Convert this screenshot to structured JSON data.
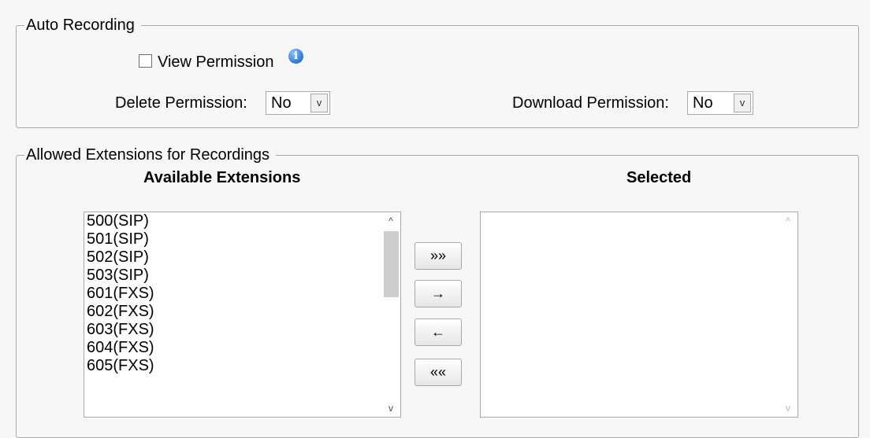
{
  "auto_recording": {
    "legend": "Auto Recording",
    "view_permission_label": "View Permission",
    "view_permission_checked": false,
    "info_glyph": "i",
    "delete_permission_label": "Delete Permission:",
    "delete_permission_value": "No",
    "download_permission_label": "Download Permission:",
    "download_permission_value": "No"
  },
  "allowed_extensions": {
    "legend": "Allowed Extensions for Recordings",
    "available_heading": "Available Extensions",
    "selected_heading": "Selected",
    "available": [
      "500(SIP)",
      "501(SIP)",
      "502(SIP)",
      "503(SIP)",
      "601(FXS)",
      "602(FXS)",
      "603(FXS)",
      "604(FXS)",
      "605(FXS)"
    ],
    "selected": [],
    "buttons": {
      "add_all": "»»",
      "add": "→",
      "remove": "←",
      "remove_all": "««"
    }
  },
  "icons": {
    "scroll_up": "^",
    "scroll_down": "v",
    "dropdown": "v"
  }
}
